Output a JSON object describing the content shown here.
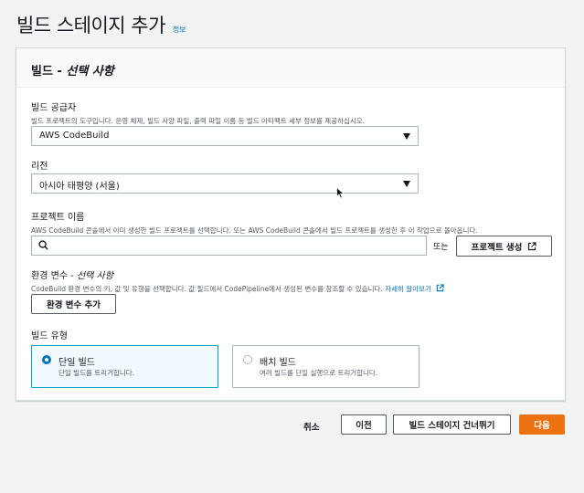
{
  "page": {
    "title": "빌드 스테이지 추가",
    "info_link": "정보"
  },
  "panel": {
    "title_main": "빌드 - ",
    "title_italic": "선택 사항"
  },
  "build_provider": {
    "label": "빌드 공급자",
    "description": "빌드 프로젝트의 도구입니다. 운영 체제, 빌드 사양 파일, 출력 파일 이름 등 빌드 아티팩트 세부 정보를 제공하십시오.",
    "selected": "AWS CodeBuild"
  },
  "region": {
    "label": "리전",
    "selected": "아시아 태평양 (서울)"
  },
  "project_name": {
    "label": "프로젝트 이름",
    "description": "AWS CodeBuild 콘솔에서 이미 생성한 빌드 프로젝트를 선택합니다. 또는 AWS CodeBuild 콘솔에서 빌드 프로젝트를 생성한 후 이 작업으로 돌아옵니다.",
    "search_value": "",
    "or_text": "또는",
    "create_button": "프로젝트 생성"
  },
  "env_vars": {
    "label_main": "환경 변수 - ",
    "label_italic": "선택 사항",
    "description": "CodeBuild 환경 변수의 키, 값 및 유형을 선택합니다. 값 필드에서 CodePipeline에서 생성된 변수를 참조할 수 있습니다.",
    "learn_more": "자세히 알아보기",
    "add_button": "환경 변수 추가"
  },
  "build_type": {
    "label": "빌드 유형",
    "options": [
      {
        "title": "단일 빌드",
        "description": "단일 빌드를 트리거합니다.",
        "selected": true
      },
      {
        "title": "배치 빌드",
        "description": "여러 빌드를 단일 실행으로 트리거합니다.",
        "selected": false
      }
    ]
  },
  "footer": {
    "cancel": "취소",
    "previous": "이전",
    "skip": "빌드 스테이지 건너뛰기",
    "next": "다음"
  },
  "colors": {
    "primary": "#ec7211",
    "link": "#0073bb",
    "selected_tile_border": "#00a1c9"
  }
}
